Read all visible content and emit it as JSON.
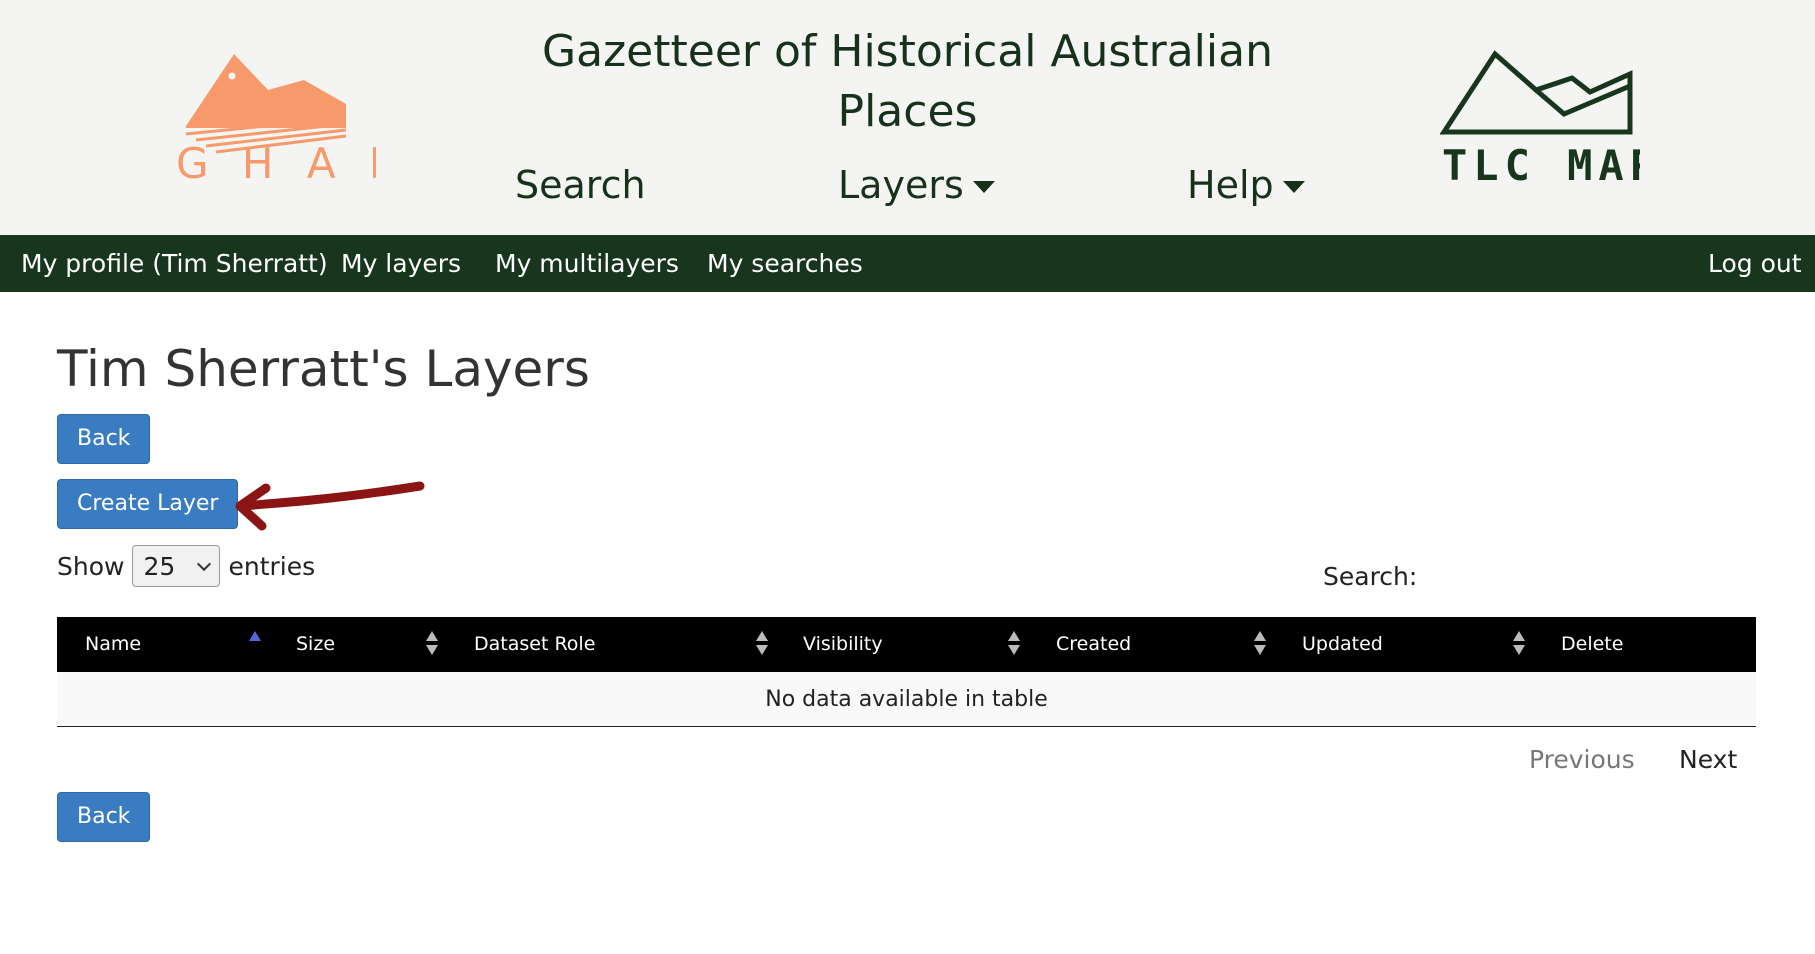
{
  "header": {
    "title": "Gazetteer of Historical Australian Places",
    "ghap_logo_text": "G H A P",
    "tlc_logo_text": "TLC MAP",
    "nav": {
      "search": "Search",
      "layers": "Layers",
      "help": "Help"
    }
  },
  "user_bar": {
    "profile": "My profile (Tim Sherratt)",
    "layers": "My layers",
    "multilayers": "My multilayers",
    "searches": "My searches",
    "logout": "Log out"
  },
  "page": {
    "title": "Tim Sherratt's Layers",
    "back_label": "Back",
    "create_label": "Create Layer",
    "show_prefix": "Show",
    "show_value": "25",
    "show_suffix": "entries",
    "search_label": "Search:"
  },
  "table": {
    "columns": [
      "Name",
      "Size",
      "Dataset Role",
      "Visibility",
      "Created",
      "Updated",
      "Delete"
    ],
    "empty_message": "No data available in table"
  },
  "pagination": {
    "previous": "Previous",
    "next": "Next"
  },
  "colors": {
    "ghap_orange": "#f79a6b",
    "dark_green": "#17361d",
    "button_blue": "#3a7cc1",
    "annotation_red": "#8b1414"
  }
}
